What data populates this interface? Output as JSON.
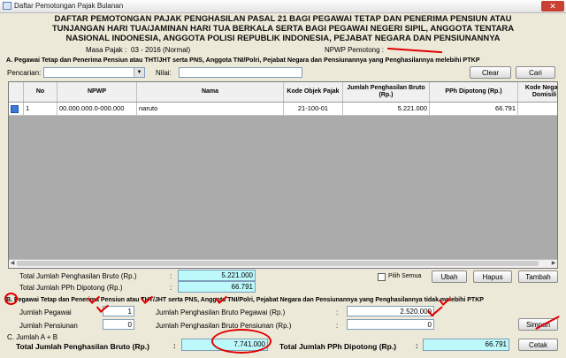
{
  "window": {
    "title": "Daftar Pemotongan Pajak Bulanan",
    "close": "✕"
  },
  "header": {
    "line1": "DAFTAR PEMOTONGAN PAJAK PENGHASILAN PASAL 21 BAGI PEGAWAI TETAP DAN PENERIMA PENSIUN ATAU",
    "line2": "TUNJANGAN HARI TUA/JAMINAN HARI TUA BERKALA SERTA BAGI PEGAWAI NEGERI SIPIL, ANGGOTA TENTARA",
    "line3": "NASIONAL INDONESIA, ANGGOTA POLISI REPUBLIK INDONESIA, PEJABAT NEGARA DAN PENSIUNANNYA",
    "masa_label": "Masa Pajak :",
    "masa_value": "03 - 2016 (Normal)",
    "npwp_label": "NPWP Pemotong :"
  },
  "sectionA": {
    "title": "A. Pegawai Tetap dan Penerima Pensiun atau THT/JHT serta PNS, Anggota TNI/Polri, Pejabat Negara dan Pensiunannya yang Penghasilannya melebihi PTKP",
    "search_label": "Pencarian:",
    "nilai_label": "Nilai:",
    "nilai_value": "",
    "clear_button": "Clear",
    "cari_button": "Cari",
    "columns": [
      "No",
      "NPWP",
      "Nama",
      "Kode Objek Pajak",
      "Jumlah Penghasilan Bruto (Rp.)",
      "PPh Dipotong (Rp.)",
      "Kode Negara Domisili"
    ],
    "rows": [
      {
        "no": "1",
        "npwp": "00.000.000.0-000.000",
        "nama": "naruto",
        "kode": "21-100-01",
        "bruto": "5.221.000",
        "pph": "66.791",
        "negara": ""
      }
    ],
    "total_bruto_label": "Total Jumlah Penghasilan Bruto (Rp.)",
    "total_bruto_value": "5.221.000",
    "total_pph_label": "Total Jumlah PPh Dipotong (Rp.)",
    "total_pph_value": "66.791",
    "pilih_semua_label": "Pilih Semua",
    "ubah_button": "Ubah",
    "hapus_button": "Hapus",
    "tambah_button": "Tambah"
  },
  "sectionB": {
    "title": "B. Pegawai Tetap dan Penerima Pensiun atau THT/JHT serta PNS, Anggota TNI/Polri, Pejabat Negara dan Pensiunannya yang Penghasilannya tidak melebihi PTKP",
    "jumlah_pegawai_label": "Jumlah Pegawai",
    "jumlah_pegawai_value": "1",
    "bruto_pegawai_label": "Jumlah Penghasilan Bruto Pegawai (Rp.)",
    "bruto_pegawai_value": "2.520.000",
    "jumlah_pensiunan_label": "Jumlah Pensiunan",
    "jumlah_pensiunan_value": "0",
    "bruto_pensiunan_label": "Jumlah Penghasilan Bruto Pensiunan (Rp.)",
    "bruto_pensiunan_value": "0",
    "simpan_button": "Simpan"
  },
  "sectionC": {
    "title": "C. Jumlah A + B",
    "total_bruto_label": "Total Jumlah Penghasilan Bruto (Rp.)",
    "total_bruto_value": "7.741.000",
    "total_pph_label": "Total Jumlah PPh Dipotong (Rp.)",
    "total_pph_value": "66.791",
    "cetak_button": "Cetak"
  },
  "colon": ":",
  "colors": {
    "accent_cyan": "#bdf8fb",
    "annotation_red": "#e00000"
  }
}
